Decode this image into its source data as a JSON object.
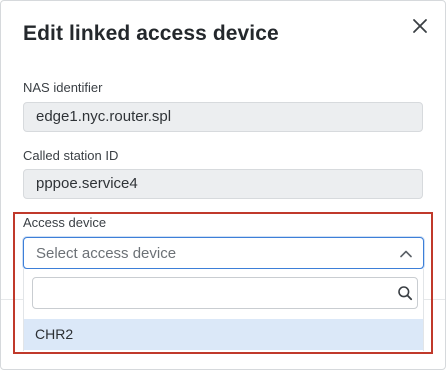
{
  "dialog": {
    "title": "Edit linked access device",
    "close_icon": "close-icon"
  },
  "fields": {
    "nas_identifier": {
      "label": "NAS identifier",
      "value": "edge1.nyc.router.spl"
    },
    "called_station_id": {
      "label": "Called station ID",
      "value": "pppoe.service4"
    },
    "access_device": {
      "label": "Access device",
      "placeholder": "Select access device",
      "state": "open",
      "chevron_icon": "chevron-up-icon"
    }
  },
  "dropdown": {
    "search_placeholder": "",
    "search_icon": "search-icon",
    "options": [
      {
        "label": "CHR2",
        "highlighted": true
      }
    ]
  },
  "colors": {
    "highlight_border": "#c0392b",
    "focus_border": "#3d7fd8",
    "option_hover": "#dbe8f8",
    "readonly_bg": "#eceef0"
  }
}
